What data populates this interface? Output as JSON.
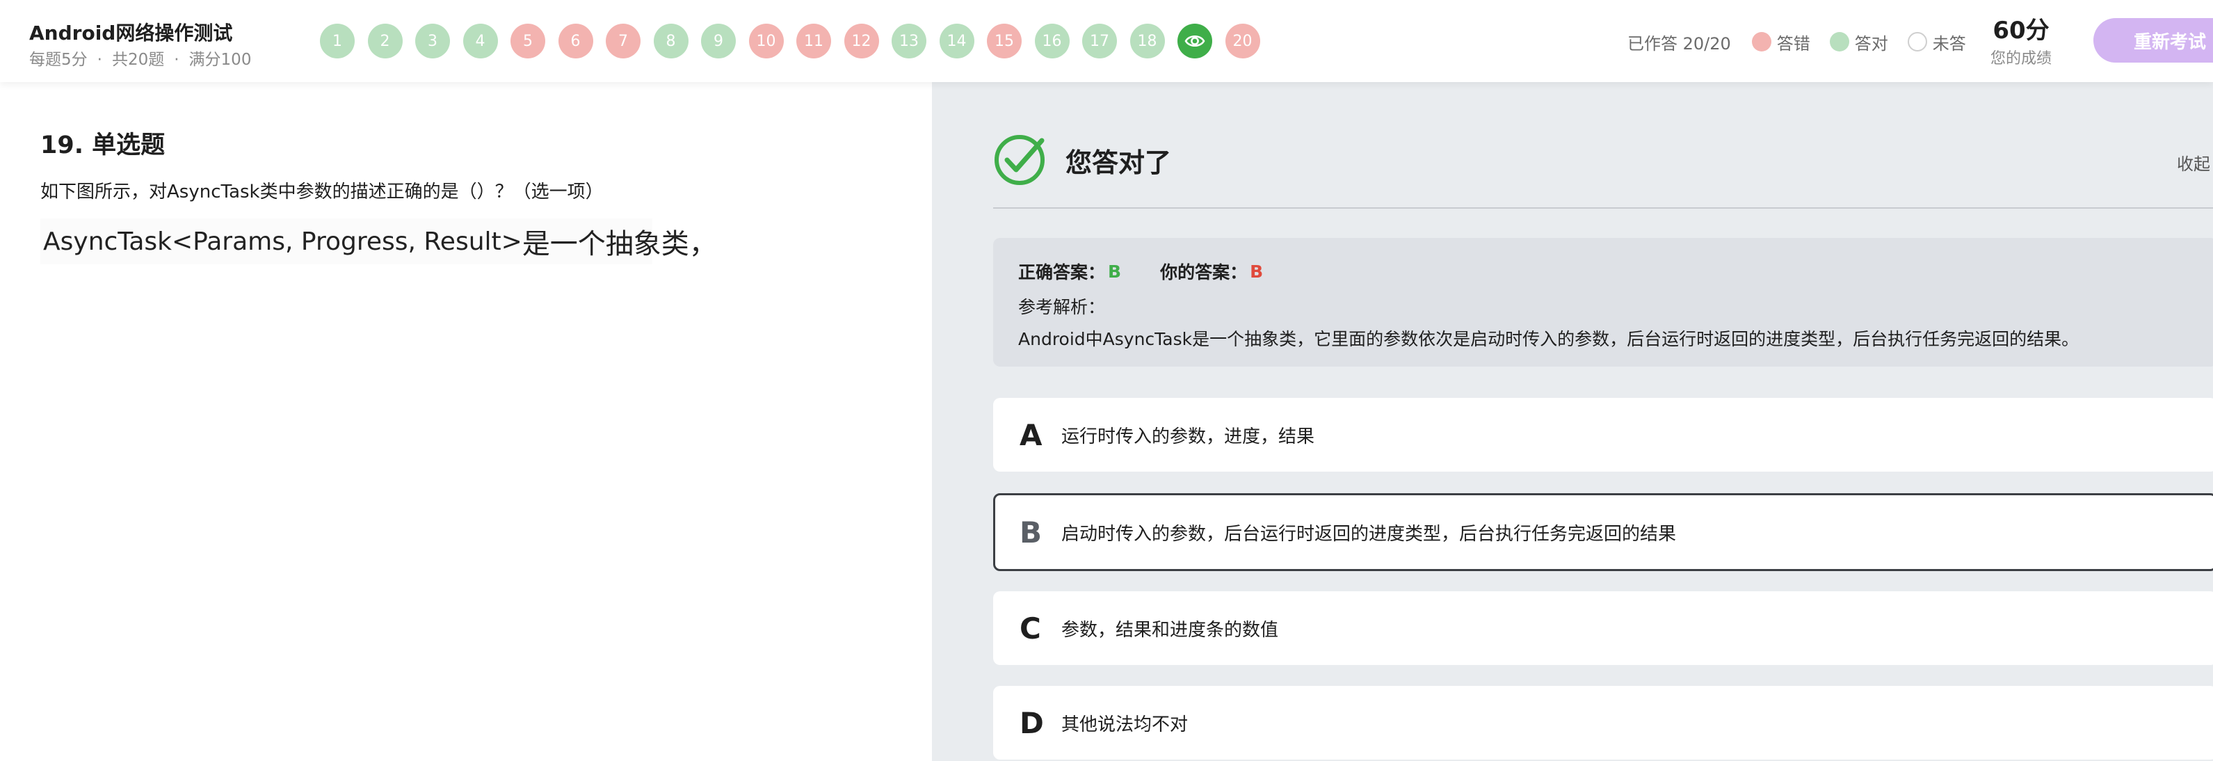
{
  "header": {
    "title": "Android网络操作测试",
    "meta": {
      "per_question": "每题5分",
      "separator": "·",
      "total": "共20题",
      "full_score": "满分100"
    },
    "questions": [
      {
        "label": "1",
        "status": "correct"
      },
      {
        "label": "2",
        "status": "correct"
      },
      {
        "label": "3",
        "status": "correct"
      },
      {
        "label": "4",
        "status": "correct"
      },
      {
        "label": "5",
        "status": "wrong"
      },
      {
        "label": "6",
        "status": "wrong"
      },
      {
        "label": "7",
        "status": "wrong"
      },
      {
        "label": "8",
        "status": "correct"
      },
      {
        "label": "9",
        "status": "correct"
      },
      {
        "label": "10",
        "status": "wrong"
      },
      {
        "label": "11",
        "status": "wrong"
      },
      {
        "label": "12",
        "status": "wrong"
      },
      {
        "label": "13",
        "status": "correct"
      },
      {
        "label": "14",
        "status": "correct"
      },
      {
        "label": "15",
        "status": "wrong"
      },
      {
        "label": "16",
        "status": "correct"
      },
      {
        "label": "17",
        "status": "correct"
      },
      {
        "label": "18",
        "status": "correct"
      },
      {
        "label": "19",
        "status": "current",
        "icon": "eye-icon"
      },
      {
        "label": "20",
        "status": "wrong"
      }
    ],
    "answered": "已作答 20/20",
    "legend": {
      "wrong": "答错",
      "correct": "答对",
      "unanswered": "未答"
    },
    "score": "60分",
    "score_label": "您的成绩",
    "restart_button": "重新考试"
  },
  "question": {
    "heading": "19. 单选题",
    "text": "如下图所示，对AsyncTask类中参数的描述正确的是（）？（选一项）",
    "image_code": "AsyncTask<Params, Progress, Result>",
    "image_cn": "是一个抽象类，"
  },
  "result": {
    "title": "您答对了",
    "collapse": "收起",
    "correct_answer_label": "正确答案：",
    "correct_answer": "B",
    "your_answer_label": "你的答案：",
    "your_answer": "B",
    "analysis_label": "参考解析：",
    "analysis_text": "Android中AsyncTask是一个抽象类，它里面的参数依次是启动时传入的参数，后台运行时返回的进度类型，后台执行任务完返回的结果。"
  },
  "options": [
    {
      "letter": "A",
      "text": "运行时传入的参数，进度，结果"
    },
    {
      "letter": "B",
      "text": "启动时传入的参数，后台运行时返回的进度类型，后台执行任务完返回的结果",
      "selected": true
    },
    {
      "letter": "C",
      "text": "参数，结果和进度条的数值"
    },
    {
      "letter": "D",
      "text": "其他说法均不对"
    }
  ],
  "colors": {
    "correct": "#b8dfbe",
    "wrong": "#f3b3b0",
    "current": "#3fae49",
    "accent_purple": "#d3b5f2"
  }
}
